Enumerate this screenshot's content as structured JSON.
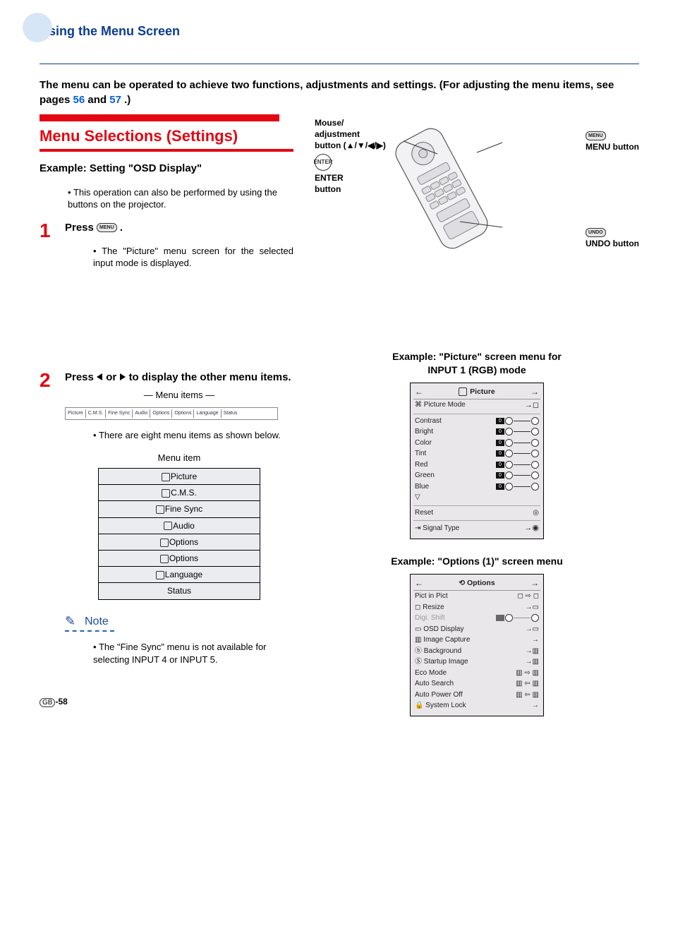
{
  "title": "Using the Menu Screen",
  "intro_a": "The menu can be operated to achieve two functions, adjustments and settings. (For adjusting the menu items, see pages ",
  "intro_link1": "56",
  "intro_mid": " and ",
  "intro_link2": "57",
  "intro_b": ".)",
  "remote": {
    "mouse_label_line1": "Mouse/",
    "mouse_label_line2": "adjustment",
    "mouse_label_line3": "button (▲/▼/◀/▶)",
    "enter_label_line1": "ENTER",
    "enter_label_line2": "button",
    "menu_label": "MENU button",
    "undo_label": "UNDO button"
  },
  "red_heading": "Menu Selections (Settings)",
  "example_heading": "Example: Setting \"OSD Display\"",
  "example_note": "This operation can also be performed by using the buttons on the projector.",
  "step1_head_a": "Press ",
  "step1_head_b": ".",
  "step1_body": "The \"Picture\" menu screen for the selected input mode is displayed.",
  "step2_head_a": "Press ",
  "step2_head_b": " or ",
  "step2_head_c": " to display the other menu items.",
  "menu_items_label": "Menu items",
  "step2_body": "There are eight menu items as shown below.",
  "menu_item_header": "Menu item",
  "menu_items": [
    "Picture",
    "C.M.S.",
    "Fine Sync",
    "Audio",
    "Options",
    "Options",
    "Language",
    "Status"
  ],
  "menu_bar_items": [
    "Picture",
    "C.M.S.",
    "Fine Sync",
    "Audio",
    "Options",
    "Options",
    "Language",
    "Status"
  ],
  "note_title": "Note",
  "note_body": "The \"Fine Sync\" menu is not available for selecting INPUT 4 or INPUT 5.",
  "example_right1_caption_a": "Example: \"Picture\" screen menu for",
  "example_right1_caption_b": "INPUT 1 (RGB) mode",
  "picture_panel": {
    "title": "Picture",
    "mode": "Picture Mode",
    "rows": [
      "Contrast",
      "Bright",
      "Color",
      "Tint",
      "Red",
      "Green",
      "Blue"
    ],
    "reset": "Reset",
    "signal": "Signal Type"
  },
  "example_right2_caption": "Example: \"Options (1)\" screen menu",
  "options_panel": {
    "title": "Options",
    "rows": [
      {
        "label": "Pict in Pict"
      },
      {
        "label": "Resize"
      },
      {
        "label": "Digi. Shift",
        "disabled": true
      },
      {
        "label": "OSD Display"
      },
      {
        "label": "Image Capture"
      },
      {
        "label": "Background"
      },
      {
        "label": "Startup Image"
      },
      {
        "label": "Eco Mode"
      },
      {
        "label": "Auto Search"
      },
      {
        "label": "Auto Power Off"
      },
      {
        "label": "System Lock"
      }
    ]
  },
  "page_num": "-58",
  "gb": "GB"
}
